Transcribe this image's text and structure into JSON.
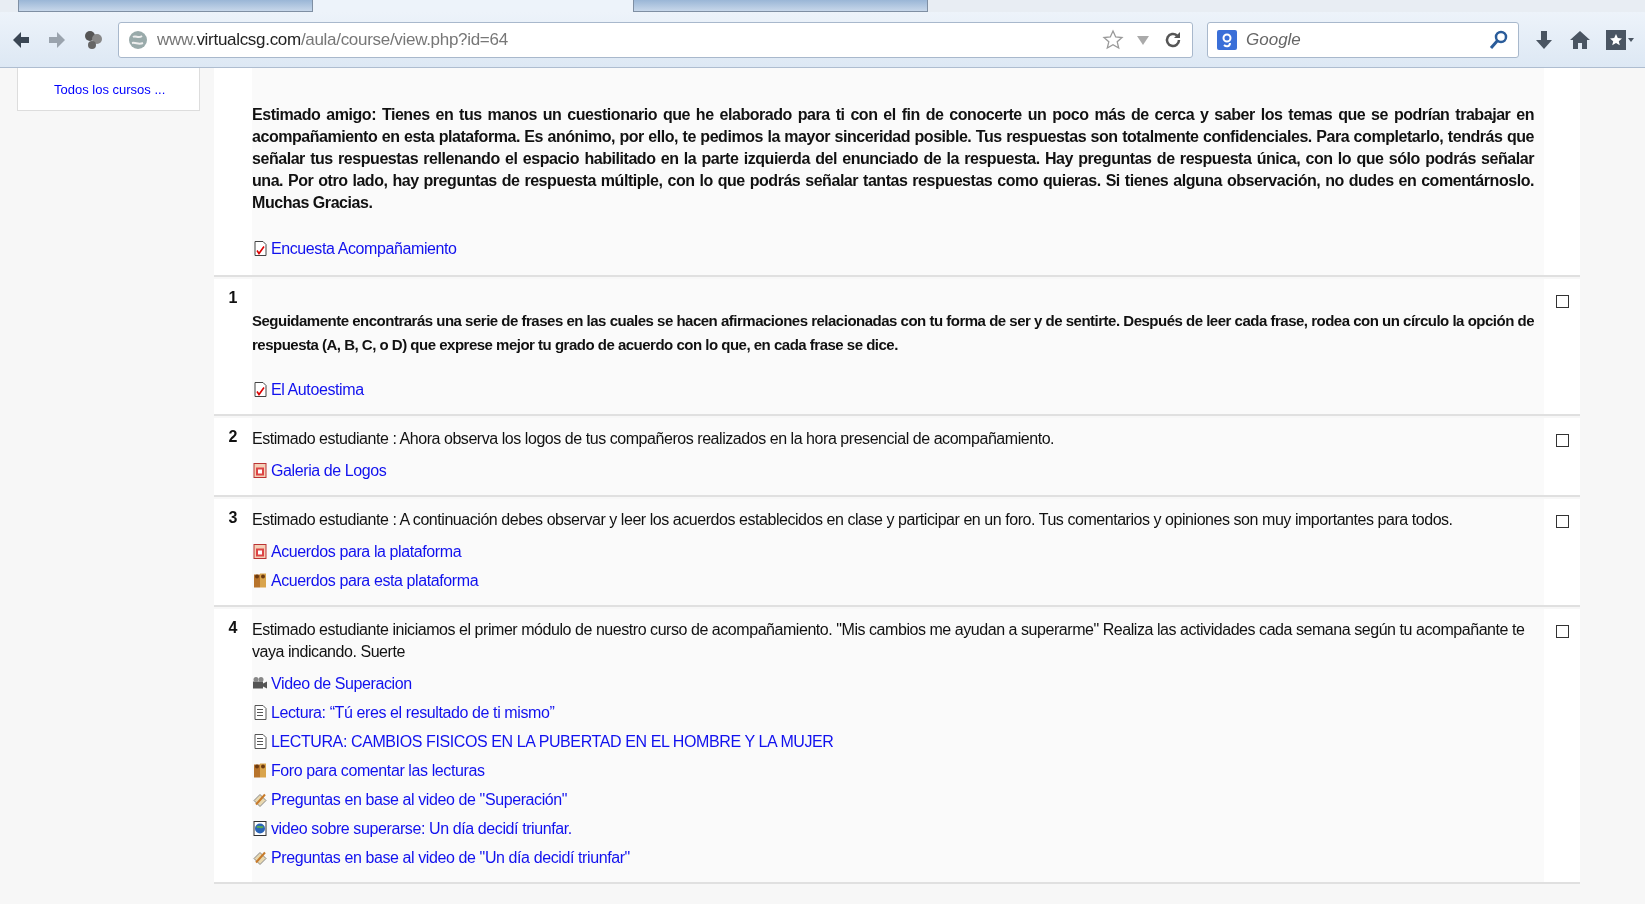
{
  "browser": {
    "tabs": [
      {
        "selected": false
      },
      {
        "selected": true
      },
      {
        "selected": false
      }
    ],
    "url": "www.**virtualcsg.com**/aula/course/view.php?id=64",
    "search": {
      "placeholder": "Google"
    }
  },
  "sidebar": {
    "links": [
      "Todos los cursos ..."
    ]
  },
  "sections": [
    {
      "summary": "Estimado amigo: Tienes en tus manos un cuestionario que he elaborado para ti con el fin de conocerte un poco más de cerca y saber los temas que se podrían trabajar en acompañamiento en esta plataforma. Es anónimo, por ello, te pedimos la mayor sinceridad posible. Tus respuestas son totalmente confidenciales. Para completarlo, tendrás que señalar tus respuestas rellenando el espacio habilitado en la parte izquierda del enunciado de la respuesta. Hay preguntas de respuesta única, con lo que sólo podrás señalar una. Por otro lado, hay preguntas de respuesta múltiple, con lo que podrás señalar tantas respuestas como quieras. Si tienes alguna observación, no dudes en comentárnoslo. Muchas Gracias.",
      "bold": true,
      "links": [
        {
          "kind": "quiz",
          "label": "Encuesta Acompañamiento"
        }
      ]
    },
    {
      "number": "1",
      "summary": "Seguidamente encontrarás una serie de frases en las cuales se hacen afirmaciones relacionadas con tu forma de ser y de sentirte. Después de leer cada frase, rodea con un círculo la opción de respuesta (A, B, C, o D) que exprese mejor tu grado de acuerdo con lo que, en cada frase se dice.",
      "bold": true,
      "checked": false,
      "links": [
        {
          "kind": "quiz",
          "label": "El Autoestima"
        }
      ]
    },
    {
      "number": "2",
      "summary": "Estimado estudiante : Ahora observa los logos de tus compañeros realizados en la hora presencial de acompañamiento.",
      "bold": false,
      "checked": false,
      "links": [
        {
          "kind": "pdf",
          "label": "Galeria de Logos"
        }
      ]
    },
    {
      "number": "3",
      "summary": "Estimado estudiante : A continuación debes observar y leer los acuerdos establecidos en clase y participar en un foro. Tus comentarios y opiniones son muy importantes para todos.",
      "bold": false,
      "checked": false,
      "links": [
        {
          "kind": "pdf",
          "label": "Acuerdos para la plataforma"
        },
        {
          "kind": "forum",
          "label": "Acuerdos para esta plataforma"
        }
      ]
    },
    {
      "number": "4",
      "summary": "Estimado estudiante iniciamos el primer módulo de nuestro curso de acompañamiento. \"Mis cambios me ayudan a superarme\" Realiza las actividades cada semana según tu acompañante te vaya indicando. Suerte",
      "bold": false,
      "checked": false,
      "links": [
        {
          "kind": "video",
          "label": "Video de Superacion"
        },
        {
          "kind": "page",
          "label": "Lectura: “Tú eres el resultado de ti mismo”"
        },
        {
          "kind": "page",
          "label": "LECTURA: CAMBIOS FISICOS EN LA PUBERTAD EN EL HOMBRE Y LA MUJER"
        },
        {
          "kind": "forum",
          "label": "Foro para comentar las lecturas"
        },
        {
          "kind": "questionnaire",
          "label": "Preguntas en base al video de \"Superación\""
        },
        {
          "kind": "url",
          "label": "video sobre superarse: Un día decidí triunfar."
        },
        {
          "kind": "questionnaire",
          "label": "Preguntas en base al video de \"Un día decidí triunfar\""
        }
      ]
    }
  ]
}
